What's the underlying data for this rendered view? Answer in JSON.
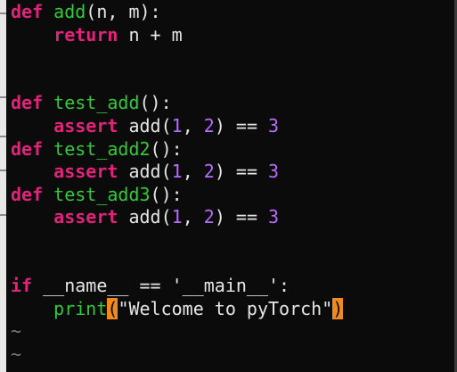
{
  "editor": {
    "lines": [
      {
        "segments": [
          {
            "t": "def",
            "c": "kw"
          },
          {
            "t": " ",
            "c": "plain"
          },
          {
            "t": "add",
            "c": "fn"
          },
          {
            "t": "(n, m):",
            "c": "plain"
          }
        ]
      },
      {
        "segments": [
          {
            "t": "    ",
            "c": "plain"
          },
          {
            "t": "return",
            "c": "kw"
          },
          {
            "t": " n + m",
            "c": "plain"
          }
        ]
      },
      {
        "segments": []
      },
      {
        "segments": []
      },
      {
        "segments": [
          {
            "t": "def",
            "c": "kw"
          },
          {
            "t": " ",
            "c": "plain"
          },
          {
            "t": "test_add",
            "c": "fn"
          },
          {
            "t": "():",
            "c": "plain"
          }
        ]
      },
      {
        "segments": [
          {
            "t": "    ",
            "c": "plain"
          },
          {
            "t": "assert",
            "c": "kw"
          },
          {
            "t": " add(",
            "c": "plain"
          },
          {
            "t": "1",
            "c": "num"
          },
          {
            "t": ", ",
            "c": "plain"
          },
          {
            "t": "2",
            "c": "num"
          },
          {
            "t": ") == ",
            "c": "plain"
          },
          {
            "t": "3",
            "c": "num"
          }
        ]
      },
      {
        "segments": [
          {
            "t": "def",
            "c": "kw"
          },
          {
            "t": " ",
            "c": "plain"
          },
          {
            "t": "test_add2",
            "c": "fn"
          },
          {
            "t": "():",
            "c": "plain"
          }
        ]
      },
      {
        "segments": [
          {
            "t": "    ",
            "c": "plain"
          },
          {
            "t": "assert",
            "c": "kw"
          },
          {
            "t": " add(",
            "c": "plain"
          },
          {
            "t": "1",
            "c": "num"
          },
          {
            "t": ", ",
            "c": "plain"
          },
          {
            "t": "2",
            "c": "num"
          },
          {
            "t": ") == ",
            "c": "plain"
          },
          {
            "t": "3",
            "c": "num"
          }
        ]
      },
      {
        "segments": [
          {
            "t": "def",
            "c": "kw"
          },
          {
            "t": " ",
            "c": "plain"
          },
          {
            "t": "test_add3",
            "c": "fn"
          },
          {
            "t": "():",
            "c": "plain"
          }
        ]
      },
      {
        "segments": [
          {
            "t": "    ",
            "c": "plain"
          },
          {
            "t": "assert",
            "c": "kw"
          },
          {
            "t": " add(",
            "c": "plain"
          },
          {
            "t": "1",
            "c": "num"
          },
          {
            "t": ", ",
            "c": "plain"
          },
          {
            "t": "2",
            "c": "num"
          },
          {
            "t": ") == ",
            "c": "plain"
          },
          {
            "t": "3",
            "c": "num"
          }
        ]
      },
      {
        "segments": []
      },
      {
        "segments": []
      },
      {
        "segments": [
          {
            "t": "if",
            "c": "kw"
          },
          {
            "t": " __name__ == '__main__':",
            "c": "plain"
          }
        ]
      },
      {
        "segments": [
          {
            "t": "    ",
            "c": "plain"
          },
          {
            "t": "print",
            "c": "fn"
          },
          {
            "t": "(",
            "c": "paren-hl"
          },
          {
            "t": "\"Welcome to pyTorch\"",
            "c": "plain"
          },
          {
            "t": ")",
            "c": "paren-hl"
          }
        ]
      },
      {
        "segments": [
          {
            "t": "~",
            "c": "tilde"
          }
        ]
      },
      {
        "segments": [
          {
            "t": "~",
            "c": "tilde"
          }
        ]
      }
    ]
  },
  "colors": {
    "background": "#0b0b0b",
    "keyword": "#e0247a",
    "function": "#34c93a",
    "number": "#b86cff",
    "text": "#e6e6e6",
    "match_paren_bg": "#f08a1c",
    "tilde": "#7a7a7a"
  }
}
